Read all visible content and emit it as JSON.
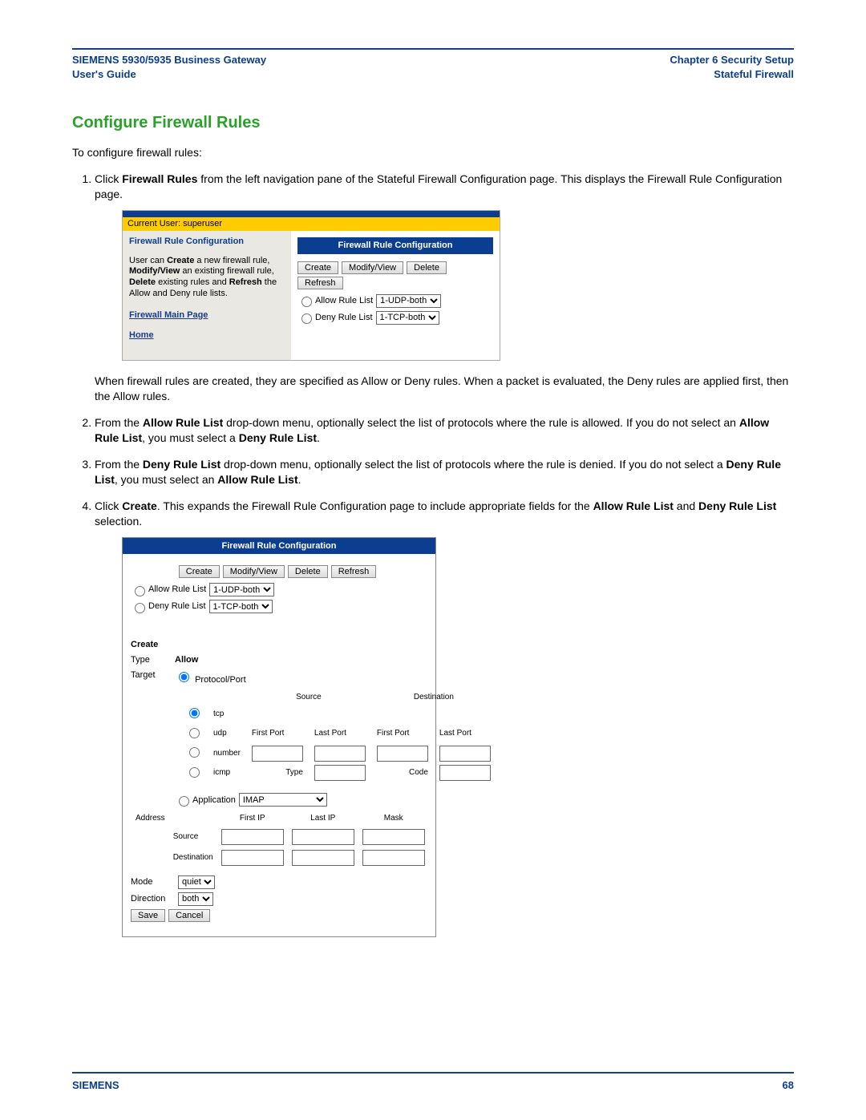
{
  "header": {
    "left_line1": "SIEMENS 5930/5935 Business Gateway",
    "left_line2": "User's Guide",
    "right_line1": "Chapter 6  Security Setup",
    "right_line2": "Stateful Firewall"
  },
  "section_title": "Configure Firewall Rules",
  "intro": "To configure firewall rules:",
  "steps": {
    "s1_a": "Click ",
    "s1_b": "Firewall Rules",
    "s1_c": " from the left navigation pane of the Stateful Firewall Configuration page. This displays the Firewall Rule Configuration page.",
    "s1_after": "When firewall rules are created, they are specified as Allow or Deny rules. When a packet is evaluated, the Deny rules are applied first, then the Allow rules.",
    "s2_a": "From the ",
    "s2_b": "Allow Rule List",
    "s2_c": " drop-down menu, optionally select the list of protocols where the rule is allowed. If you do not select an ",
    "s2_d": "Allow Rule List",
    "s2_e": ", you must select a ",
    "s2_f": "Deny Rule List",
    "s2_g": ".",
    "s3_a": "From the ",
    "s3_b": "Deny Rule List",
    "s3_c": " drop-down menu, optionally select the list of protocols where the rule is denied. If you do not select a ",
    "s3_d": "Deny Rule List",
    "s3_e": ", you must select an ",
    "s3_f": "Allow Rule List",
    "s3_g": ".",
    "s4_a": "Click ",
    "s4_b": "Create",
    "s4_c": ". This expands the Firewall Rule Configuration page to include appropriate fields for the ",
    "s4_d": "Allow Rule List",
    "s4_e": " and ",
    "s4_f": "Deny Rule List",
    "s4_g": " selection."
  },
  "fig1": {
    "current_user": "Current User: superuser",
    "sidebar_title": "Firewall Rule Configuration",
    "sidebar_text_a": "User can ",
    "sidebar_text_create": "Create",
    "sidebar_text_b": " a new firewall rule, ",
    "sidebar_text_modify": "Modify/View",
    "sidebar_text_c": " an existing firewall rule, ",
    "sidebar_text_delete": "Delete",
    "sidebar_text_d": " existing rules and ",
    "sidebar_text_refresh": "Refresh",
    "sidebar_text_e": " the Allow and Deny rule lists.",
    "link_main": "Firewall Main Page",
    "link_home": "Home",
    "panel_title": "Firewall Rule Configuration",
    "btn_create": "Create",
    "btn_modify": "Modify/View",
    "btn_delete": "Delete",
    "btn_refresh": "Refresh",
    "allow_label": "Allow Rule List",
    "allow_value": "1-UDP-both",
    "deny_label": "Deny Rule List",
    "deny_value": "1-TCP-both"
  },
  "fig2": {
    "panel_title": "Firewall Rule Configuration",
    "btn_create": "Create",
    "btn_modify": "Modify/View",
    "btn_delete": "Delete",
    "btn_refresh": "Refresh",
    "allow_label": "Allow Rule List",
    "allow_value": "1-UDP-both",
    "deny_label": "Deny Rule List",
    "deny_value": "1-TCP-both",
    "create_h": "Create",
    "type_l": "Type",
    "type_v": "Allow",
    "target_l": "Target",
    "protocol_port": "Protocol/Port",
    "tcp": "tcp",
    "udp": "udp",
    "number": "number",
    "icmp": "icmp",
    "source": "Source",
    "destination": "Destination",
    "first_port": "First Port",
    "last_port": "Last Port",
    "type_f": "Type",
    "code_f": "Code",
    "application": "Application",
    "application_v": "IMAP",
    "address": "Address",
    "first_ip": "First IP",
    "last_ip": "Last IP",
    "mask": "Mask",
    "addr_source": "Source",
    "addr_dest": "Destination",
    "mode_l": "Mode",
    "mode_v": "quiet",
    "direction_l": "Direction",
    "direction_v": "both",
    "save": "Save",
    "cancel": "Cancel"
  },
  "footer": {
    "brand": "SIEMENS",
    "page": "68"
  }
}
